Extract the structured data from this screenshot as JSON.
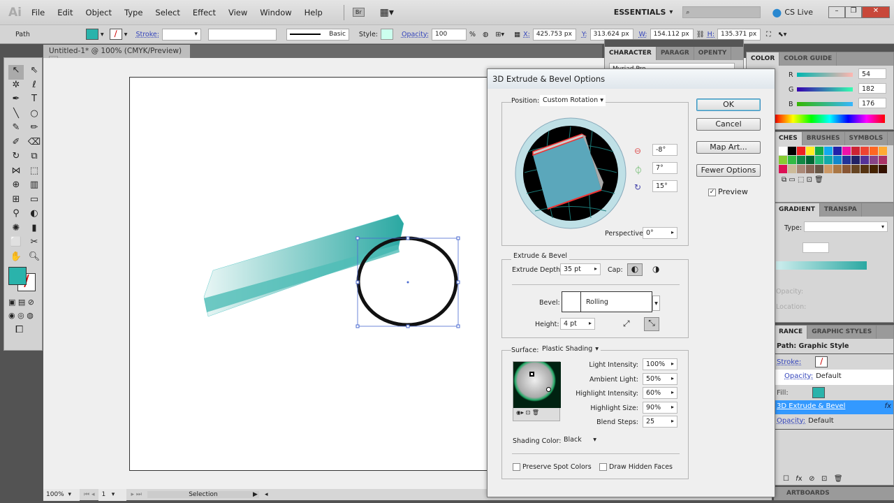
{
  "app": {
    "logo": "Ai",
    "menu": [
      "File",
      "Edit",
      "Object",
      "Type",
      "Select",
      "Effect",
      "View",
      "Window",
      "Help"
    ],
    "bridge": "Br",
    "workspace": "ESSENTIALS",
    "search_placeholder": "",
    "cs_live": "CS Live"
  },
  "control": {
    "selection": "Path",
    "stroke_label": "Stroke:",
    "brush": "Basic",
    "style_label": "Style:",
    "opacity_label": "Opacity:",
    "opacity": "100",
    "pct": "%",
    "x_label": "X:",
    "x": "425.753 px",
    "y_label": "Y:",
    "y": "313.624 px",
    "w_label": "W:",
    "w": "154.112 px",
    "h_label": "H:",
    "h": "135.371 px"
  },
  "document": {
    "tab": "Untitled-1* @ 100% (CMYK/Preview)"
  },
  "status": {
    "zoom": "100%",
    "page": "1",
    "mode": "Selection"
  },
  "colors": {
    "fill": "#2ab3ab",
    "teal": "#36b6b0",
    "accent_select": "#3399ff"
  },
  "character_panel": {
    "tabs": [
      "CHARACTER",
      "PARAGR",
      "OPENTY"
    ],
    "font": "Myriad Pro"
  },
  "color_panel": {
    "tabs": [
      "COLOR",
      "COLOR GUIDE"
    ],
    "r": "54",
    "g": "182",
    "b": "176",
    "labels": [
      "R",
      "G",
      "B"
    ]
  },
  "swatches_panel": {
    "tabs": [
      "CHES",
      "BRUSHES",
      "SYMBOLS"
    ]
  },
  "gradient_panel": {
    "tabs": [
      "GRADIENT",
      "TRANSPA"
    ],
    "type_label": "Type:",
    "opacity_label": "Opacity:",
    "location_label": "Location:"
  },
  "appearance_panel": {
    "tabs": [
      "RANCE",
      "GRAPHIC STYLES"
    ],
    "title": "Path: Graphic Style",
    "stroke": "Stroke:",
    "opacity1": "Opacity:",
    "default1": "Default",
    "fill": "Fill:",
    "effect": "3D Extrude & Bevel",
    "fx": "fx",
    "opacity2": "Opacity:",
    "default2": "Default"
  },
  "artboards_panel": {
    "tab": "ARTBOARDS"
  },
  "dialog": {
    "title": "3D Extrude & Bevel Options",
    "position_label": "Position:",
    "position": "Custom Rotation",
    "rot_x": "-8°",
    "rot_y": "7°",
    "rot_z": "15°",
    "perspective_label": "Perspective:",
    "perspective": "0°",
    "ok": "OK",
    "cancel": "Cancel",
    "map_art": "Map Art...",
    "fewer": "Fewer Options",
    "preview": "Preview",
    "preview_checked": true,
    "extrude_group": "Extrude & Bevel",
    "depth_label": "Extrude Depth:",
    "depth": "35 pt",
    "cap_label": "Cap:",
    "bevel_label": "Bevel:",
    "bevel": "Rolling",
    "height_label": "Height:",
    "height": "4 pt",
    "surface_label": "Surface:",
    "surface": "Plastic Shading",
    "light_intensity_label": "Light Intensity:",
    "light_intensity": "100%",
    "ambient_label": "Ambient Light:",
    "ambient": "50%",
    "highlight_intensity_label": "Highlight Intensity:",
    "highlight_intensity": "60%",
    "highlight_size_label": "Highlight Size:",
    "highlight_size": "90%",
    "blend_label": "Blend Steps:",
    "blend": "25",
    "shading_label": "Shading Color:",
    "shading": "Black",
    "spot": "Preserve Spot Colors",
    "hidden": "Draw Hidden Faces"
  }
}
